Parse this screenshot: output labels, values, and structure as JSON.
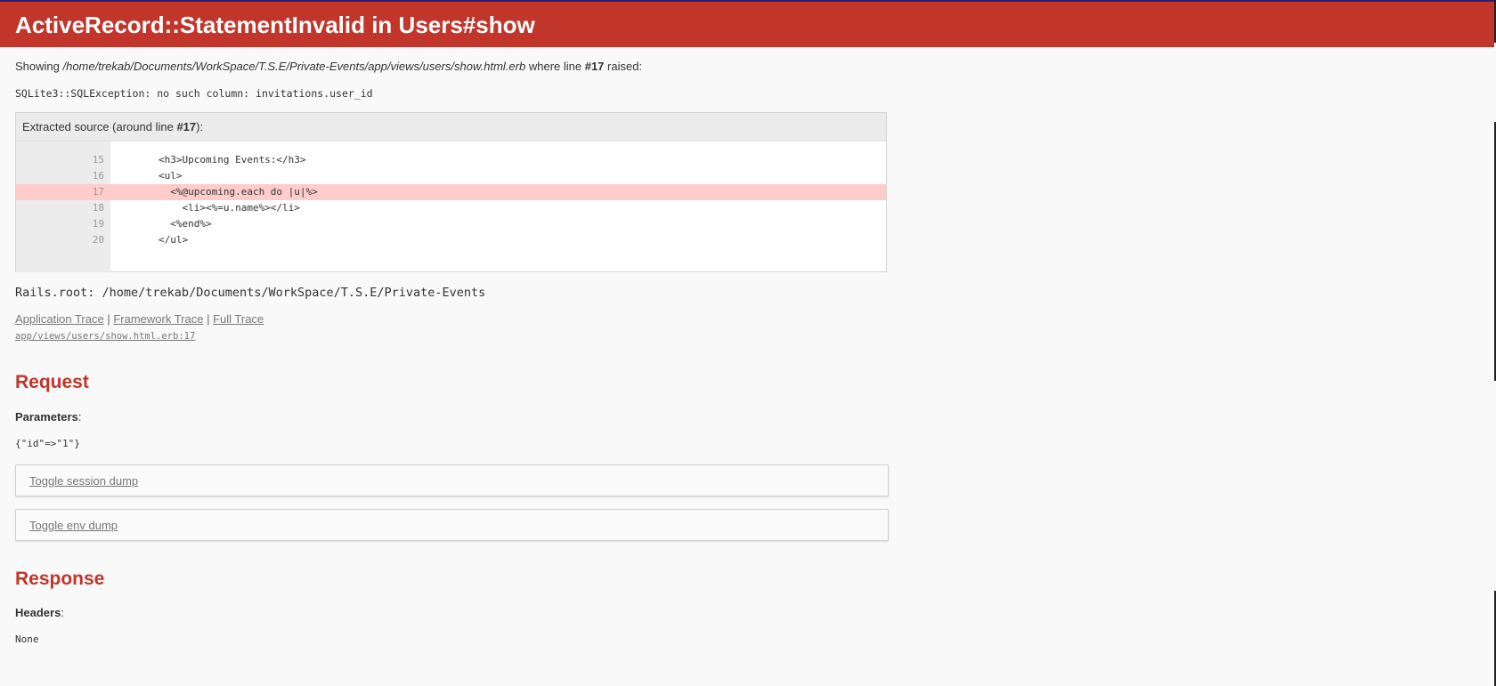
{
  "header": {
    "title": "ActiveRecord::StatementInvalid in Users#show"
  },
  "showing": {
    "prefix": "Showing ",
    "path": "/home/trekab/Documents/WorkSpace/T.S.E/Private-Events/app/views/users/show.html.erb",
    "middle": " where line ",
    "line": "#17",
    "suffix": " raised:"
  },
  "exception_message": "SQLite3::SQLException: no such column: invitations.user_id",
  "source": {
    "heading_prefix": "Extracted source (around line ",
    "heading_line": "#17",
    "heading_suffix": "):",
    "lines": [
      {
        "number": "15",
        "code": "        <h3>Upcoming Events:</h3>"
      },
      {
        "number": "16",
        "code": "        <ul>"
      },
      {
        "number": "17",
        "code": "          <%@upcoming.each do |u|%>"
      },
      {
        "number": "18",
        "code": "            <li><%=u.name%></li>"
      },
      {
        "number": "19",
        "code": "          <%end%>"
      },
      {
        "number": "20",
        "code": "        </ul>"
      }
    ],
    "highlight_line": "17"
  },
  "rails_root": "Rails.root: /home/trekab/Documents/WorkSpace/T.S.E/Private-Events",
  "traces": {
    "application": "Application Trace",
    "separator": " | ",
    "framework": "Framework Trace",
    "full": "Full Trace",
    "first_frame": "app/views/users/show.html.erb:17"
  },
  "request": {
    "heading": "Request",
    "parameters_label": "Parameters",
    "colon": ":",
    "parameters_value": "{\"id\"=>\"1\"}",
    "toggle_session": "Toggle session dump",
    "toggle_env": "Toggle env dump"
  },
  "response": {
    "heading": "Response",
    "headers_label": "Headers",
    "colon": ":",
    "headers_value": "None"
  },
  "colors": {
    "header_bg": "#c1352a",
    "highlight_bg": "#ffcccc",
    "page_bg": "#f9f9f9"
  }
}
